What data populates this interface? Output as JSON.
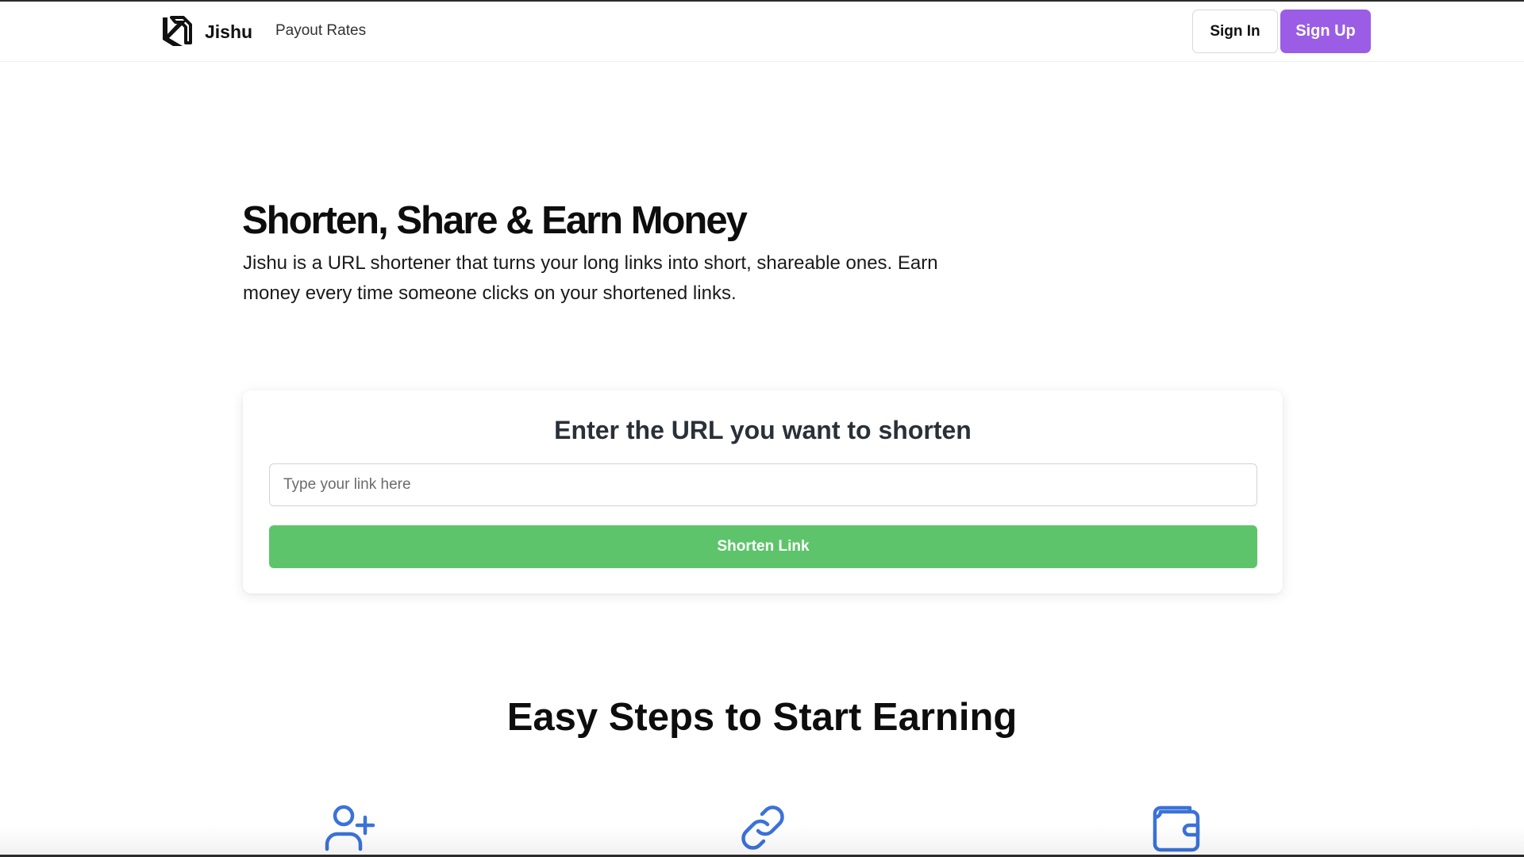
{
  "header": {
    "brand": "Jishu",
    "nav_payout": "Payout Rates",
    "signin_label": "Sign In",
    "signup_label": "Sign Up",
    "logo_icon": "jishu-logo-icon"
  },
  "hero": {
    "title": "Shorten, Share & Earn Money",
    "description": "Jishu is a URL shortener that turns your long links into short, shareable ones. Earn money every time someone clicks on your shortened links."
  },
  "shortener": {
    "title": "Enter the URL you want to shorten",
    "input_placeholder": "Type your link here",
    "input_value": "",
    "button_label": "Shorten Link"
  },
  "steps": {
    "title": "Easy Steps to Start Earning",
    "icons": [
      "user-plus-icon",
      "link-icon",
      "wallet-icon"
    ]
  },
  "colors": {
    "accent_purple": "#9b5de5",
    "button_green": "#5ec46b",
    "icon_blue": "#3b72d9"
  }
}
